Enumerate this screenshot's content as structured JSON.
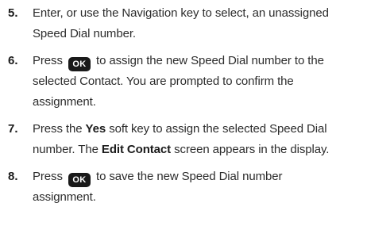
{
  "steps": [
    {
      "number": "5.",
      "lines": [
        "Enter, or use the Navigation key to select, an unassigned",
        "Speed Dial number."
      ]
    },
    {
      "number": "6.",
      "line1_pre": "Press",
      "key": "OK",
      "line1_post": "to assign the new Speed Dial number to the",
      "lines": [
        "selected Contact. You are prompted to confirm the",
        "assignment."
      ]
    },
    {
      "number": "7.",
      "line1_pre": "Press the",
      "line1_bold": "Yes",
      "line1_post": "soft key to assign the selected Speed Dial",
      "line2_pre": "number. The",
      "line2_bold": "Edit Contact",
      "line2_post": "screen appears in the display."
    },
    {
      "number": "8.",
      "line1_pre": "Press",
      "key": "OK",
      "line1_post": "to save the new Speed Dial number",
      "lines": [
        "assignment."
      ]
    }
  ]
}
